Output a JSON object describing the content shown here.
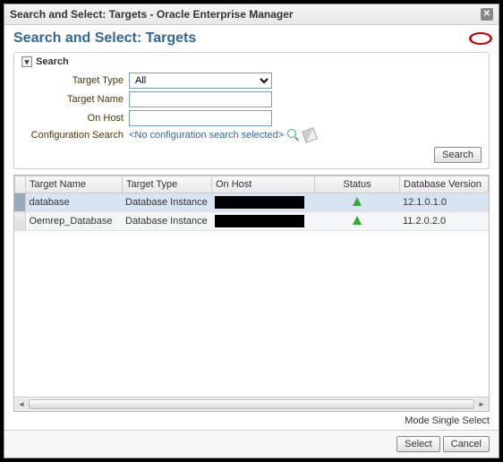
{
  "window": {
    "title": "Search and Select: Targets - Oracle Enterprise Manager"
  },
  "page": {
    "title": "Search and Select: Targets"
  },
  "search": {
    "section_label": "Search",
    "target_type_label": "Target Type",
    "target_type_value": "All",
    "target_name_label": "Target Name",
    "target_name_value": "",
    "on_host_label": "On Host",
    "on_host_value": "",
    "config_search_label": "Configuration Search",
    "config_search_value": "<No configuration search selected>",
    "search_button": "Search"
  },
  "grid": {
    "columns": {
      "target_name": "Target Name",
      "target_type": "Target Type",
      "on_host": "On Host",
      "status": "Status",
      "db_version": "Database Version"
    },
    "rows": [
      {
        "name": "database",
        "type": "Database Instance",
        "host": "(redacted)",
        "status": "up",
        "version": "12.1.0.1.0",
        "selected": true
      },
      {
        "name": "Oemrep_Database",
        "type": "Database Instance",
        "host": "(redacted)",
        "status": "up",
        "version": "11.2.0.2.0",
        "selected": false
      }
    ]
  },
  "mode": {
    "label": "Mode",
    "value": "Single Select"
  },
  "footer": {
    "select": "Select",
    "cancel": "Cancel"
  }
}
